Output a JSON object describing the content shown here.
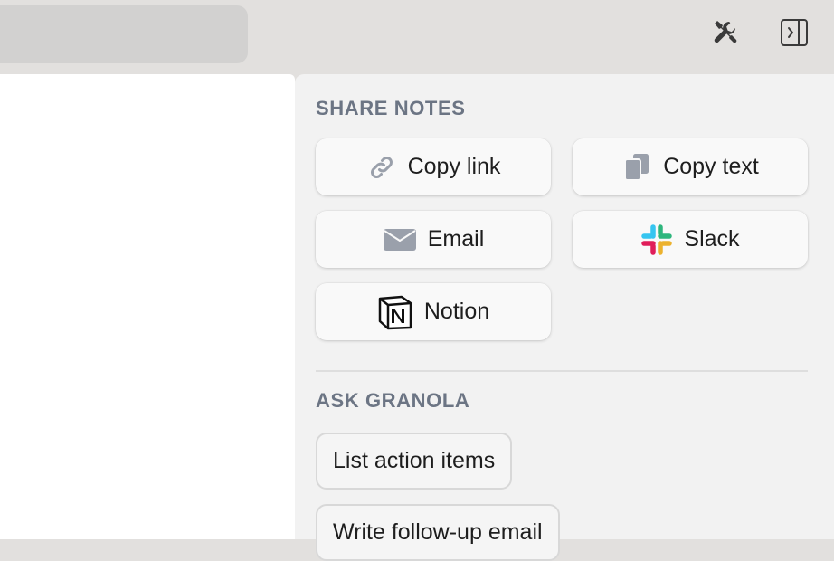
{
  "toolbar": {
    "tools_icon": "tools-icon",
    "sidebar_icon": "sidebar-toggle-icon"
  },
  "share_notes": {
    "heading": "SHARE NOTES",
    "buttons": [
      {
        "label": "Copy link",
        "icon": "link-icon"
      },
      {
        "label": "Copy text",
        "icon": "copy-icon"
      },
      {
        "label": "Email",
        "icon": "envelope-icon"
      },
      {
        "label": "Slack",
        "icon": "slack-logo-icon"
      },
      {
        "label": "Notion",
        "icon": "notion-logo-icon"
      }
    ]
  },
  "ask_granola": {
    "heading": "ASK GRANOLA",
    "prompts": [
      {
        "label": "List action items"
      },
      {
        "label": "Write follow-up email"
      }
    ]
  },
  "colors": {
    "heading": "#6c7584",
    "icon_gray": "#9aa0ab",
    "panel_bg": "#f2f2f2",
    "toolbar_bg": "#e2e0de"
  }
}
